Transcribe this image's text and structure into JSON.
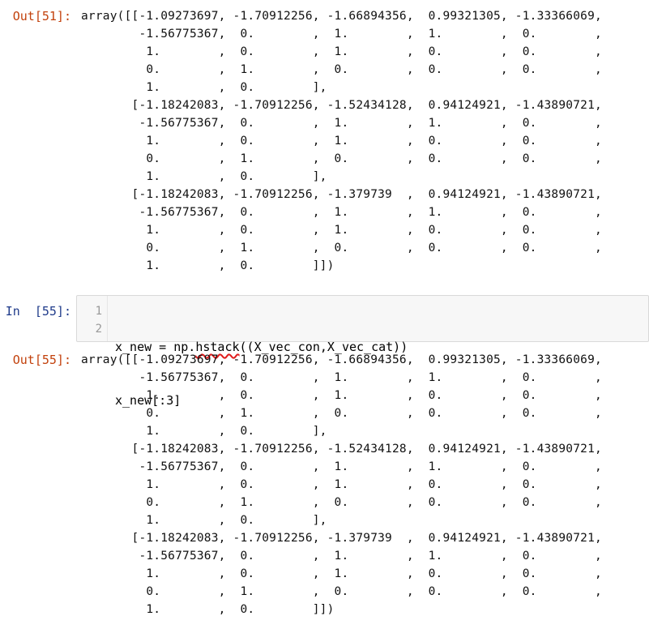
{
  "cells": [
    {
      "prompt": "Out[51]:",
      "text": "array([[-1.09273697, -1.70912256, -1.66894356,  0.99321305, -1.33366069,\n        -1.56775367,  0.        ,  1.        ,  1.        ,  0.        ,\n         1.        ,  0.        ,  1.        ,  0.        ,  0.        ,\n         0.        ,  1.        ,  0.        ,  0.        ,  0.        ,\n         1.        ,  0.        ],\n       [-1.18242083, -1.70912256, -1.52434128,  0.94124921, -1.43890721,\n        -1.56775367,  0.        ,  1.        ,  1.        ,  0.        ,\n         1.        ,  0.        ,  1.        ,  0.        ,  0.        ,\n         0.        ,  1.        ,  0.        ,  0.        ,  0.        ,\n         1.        ,  0.        ],\n       [-1.18242083, -1.70912256, -1.379739  ,  0.94124921, -1.43890721,\n        -1.56775367,  0.        ,  1.        ,  1.        ,  0.        ,\n         1.        ,  0.        ,  1.        ,  0.        ,  0.        ,\n         0.        ,  1.        ,  0.        ,  0.        ,  0.        ,\n         1.        ,  0.        ]])"
    },
    {
      "prompt": "In  [55]:",
      "line_numbers": [
        "1",
        "2"
      ],
      "code": {
        "line1_before": "x_new = np.",
        "line1_func": "hstack",
        "line1_after": "((X_vec_con,X_vec_cat))",
        "line2": "x_new[:3]"
      }
    },
    {
      "prompt": "Out[55]:",
      "text": "array([[-1.09273697, -1.70912256, -1.66894356,  0.99321305, -1.33366069,\n        -1.56775367,  0.        ,  1.        ,  1.        ,  0.        ,\n         1.        ,  0.        ,  1.        ,  0.        ,  0.        ,\n         0.        ,  1.        ,  0.        ,  0.        ,  0.        ,\n         1.        ,  0.        ],\n       [-1.18242083, -1.70912256, -1.52434128,  0.94124921, -1.43890721,\n        -1.56775367,  0.        ,  1.        ,  1.        ,  0.        ,\n         1.        ,  0.        ,  1.        ,  0.        ,  0.        ,\n         0.        ,  1.        ,  0.        ,  0.        ,  0.        ,\n         1.        ,  0.        ],\n       [-1.18242083, -1.70912256, -1.379739  ,  0.94124921, -1.43890721,\n        -1.56775367,  0.        ,  1.        ,  1.        ,  0.        ,\n         1.        ,  0.        ,  1.        ,  0.        ,  0.        ,\n         0.        ,  1.        ,  0.        ,  0.        ,  0.        ,\n         1.        ,  0.        ]])"
    }
  ],
  "colors": {
    "out_prompt": "#c2410c",
    "in_prompt": "#1e3a8a",
    "squiggle": "#e11d1d",
    "input_bg": "#f7f7f7"
  }
}
